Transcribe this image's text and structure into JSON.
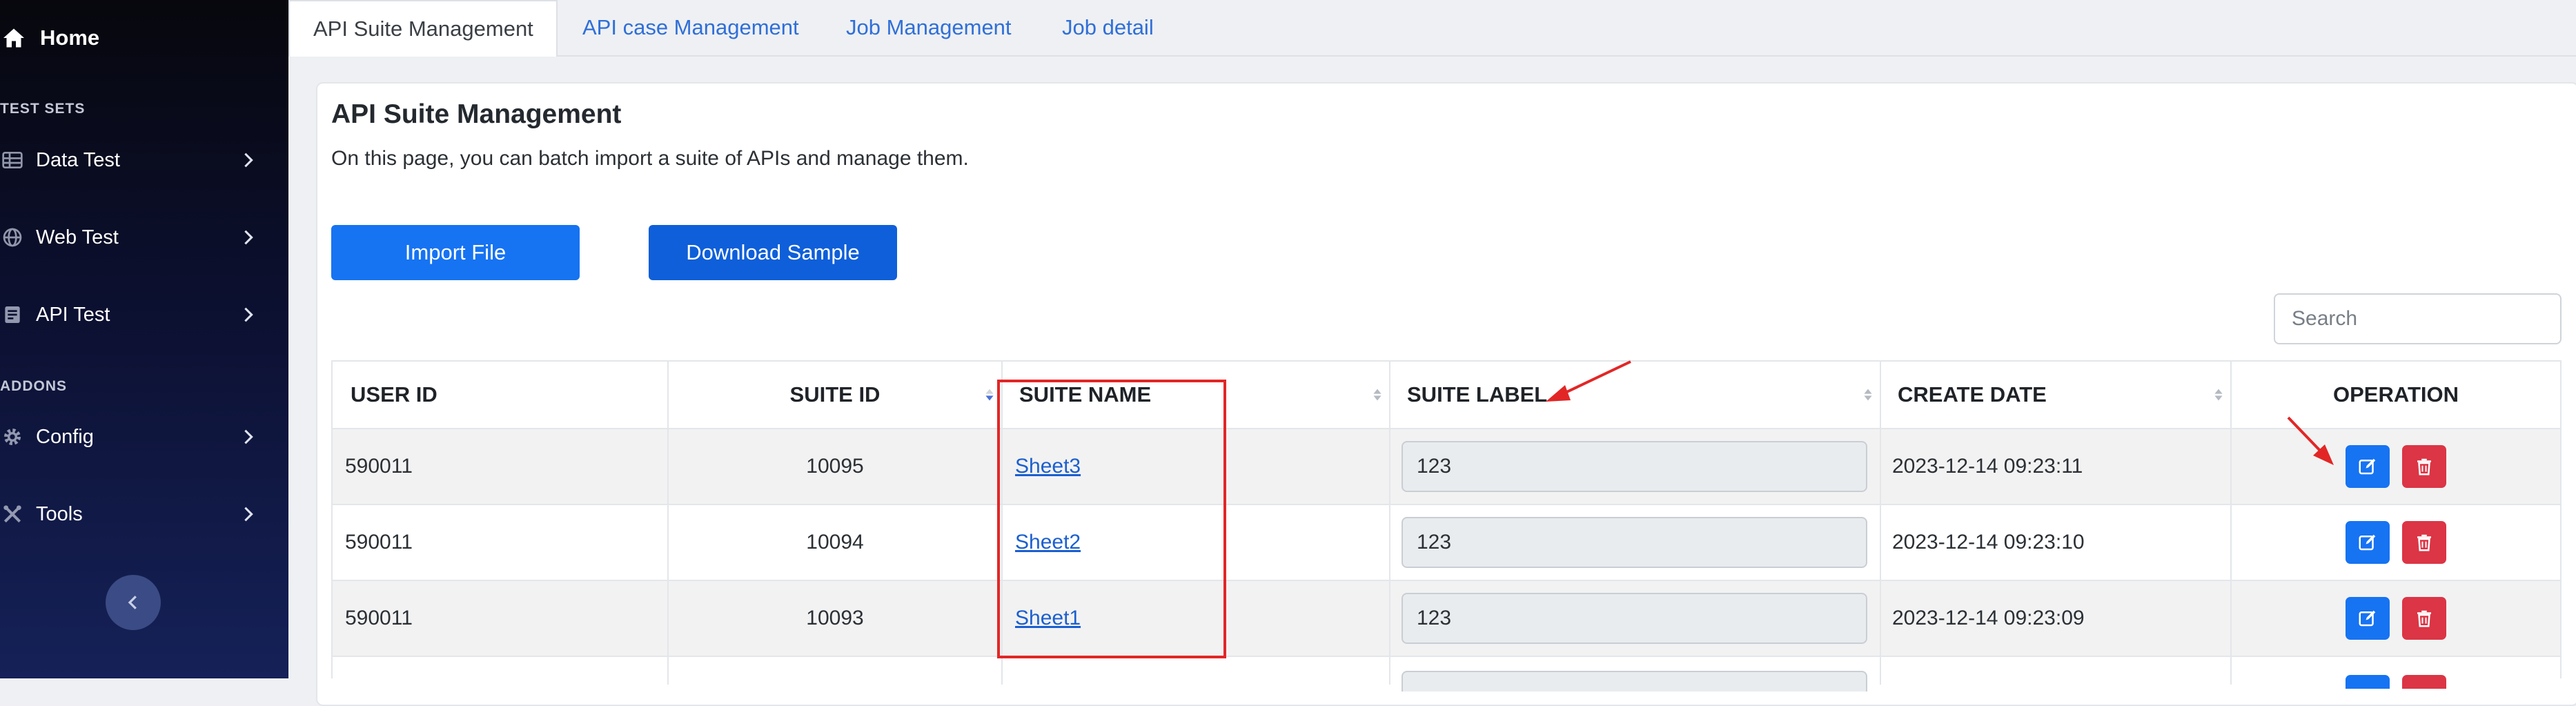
{
  "sidebar": {
    "home_label": "Home",
    "section_test_sets": "TEST SETS",
    "section_addons": "ADDONS",
    "items": [
      {
        "label": "Data Test",
        "icon": "table-icon"
      },
      {
        "label": "Web Test",
        "icon": "globe-icon"
      },
      {
        "label": "API Test",
        "icon": "document-icon"
      },
      {
        "label": "Config",
        "icon": "gear-icon"
      },
      {
        "label": "Tools",
        "icon": "tools-icon"
      }
    ]
  },
  "tabs": [
    {
      "label": "API Suite Management",
      "active": true
    },
    {
      "label": "API case Management",
      "active": false
    },
    {
      "label": "Job Management",
      "active": false
    },
    {
      "label": "Job detail",
      "active": false
    }
  ],
  "main": {
    "title": "API Suite Management",
    "description": "On this page, you can batch import a suite of APIs and manage them.",
    "import_button": "Import File",
    "download_button": "Download Sample",
    "search_placeholder": "Search"
  },
  "table": {
    "headers": {
      "user_id": "USER ID",
      "suite_id": "SUITE ID",
      "suite_name": "SUITE NAME",
      "suite_label": "SUITE LABEL",
      "create_date": "CREATE DATE",
      "operation": "OPERATION"
    },
    "rows": [
      {
        "user_id": "590011",
        "suite_id": "10095",
        "suite_name": "Sheet3",
        "suite_label": "123",
        "create_date": "2023-12-14 09:23:11"
      },
      {
        "user_id": "590011",
        "suite_id": "10094",
        "suite_name": "Sheet2",
        "suite_label": "123",
        "create_date": "2023-12-14 09:23:10"
      },
      {
        "user_id": "590011",
        "suite_id": "10093",
        "suite_name": "Sheet1",
        "suite_label": "123",
        "create_date": "2023-12-14 09:23:09"
      }
    ]
  },
  "colors": {
    "primary": "#1673f2",
    "danger": "#dc3545",
    "link": "#1b5fcf",
    "annotation": "#e22626"
  }
}
